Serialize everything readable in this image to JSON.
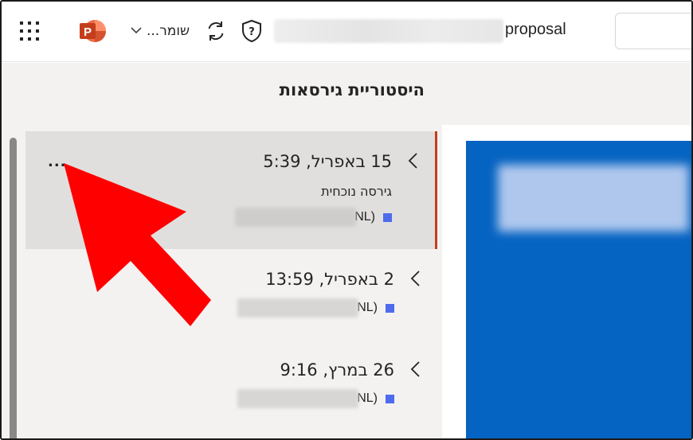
{
  "header": {
    "save_status": "שומר...",
    "title_suffix": "proposal"
  },
  "icons": {
    "apps": "apps-grid-icon",
    "app_logo": "powerpoint-icon",
    "sync": "sync-icon",
    "shield": "shield-question-icon",
    "chevron": "chevron-left-icon",
    "more": "more-icon",
    "arrow": "red-arrow-annotation"
  },
  "panel": {
    "title": "היסטוריית גירסאות",
    "versions": [
      {
        "date": "15 באפריל, 5:39",
        "current_label": "גירסה נוכחית",
        "author_suffix": "NL)",
        "more": "...",
        "selected": true
      },
      {
        "date": "2 באפריל, 13:59",
        "author_suffix": "NL)",
        "selected": false
      },
      {
        "date": "26 במרץ, 9:16",
        "author_suffix": "NL)",
        "selected": false
      }
    ]
  },
  "colors": {
    "accent": "#c43e1c",
    "slide_blue": "#0563c1",
    "panel_bg": "#f3f2f1",
    "selected_bg": "#e1dfdd",
    "author_square": "#4f6bed",
    "annotation": "#ff0000"
  }
}
